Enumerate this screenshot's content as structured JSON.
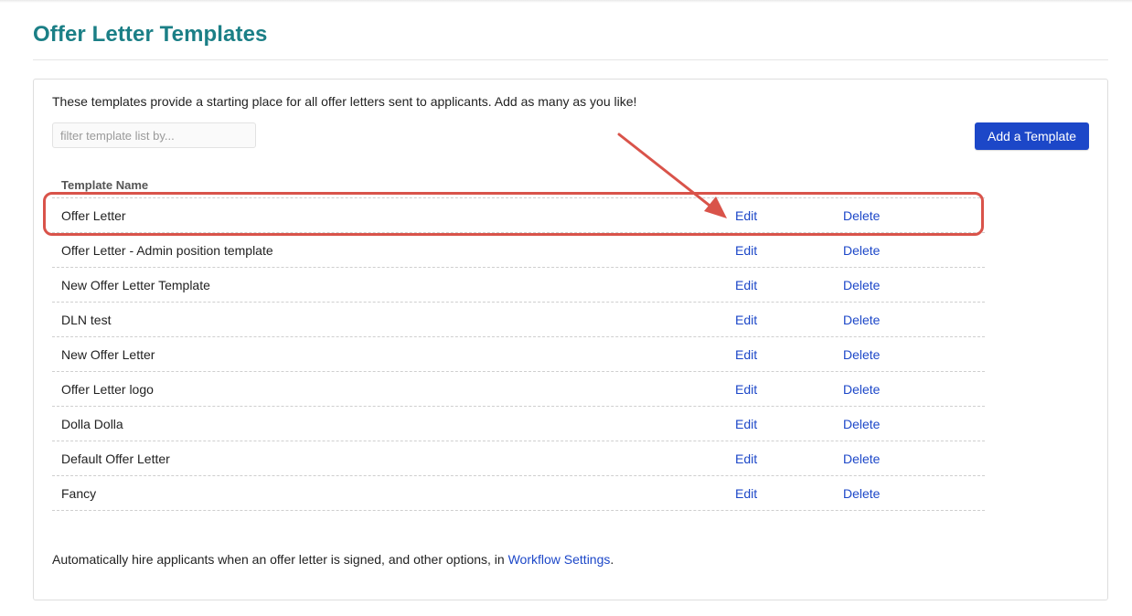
{
  "page": {
    "title": "Offer Letter Templates",
    "intro": "These templates provide a starting place for all offer letters sent to applicants. Add as many as you like!",
    "filter_placeholder": "filter template list by...",
    "add_button": "Add a Template"
  },
  "table": {
    "header": "Template Name",
    "edit_label": "Edit",
    "delete_label": "Delete",
    "rows": [
      {
        "name": "Offer Letter"
      },
      {
        "name": "Offer Letter - Admin position template"
      },
      {
        "name": "New Offer Letter Template"
      },
      {
        "name": "DLN test"
      },
      {
        "name": "New Offer Letter"
      },
      {
        "name": "Offer Letter logo"
      },
      {
        "name": "Dolla Dolla"
      },
      {
        "name": "Default Offer Letter"
      },
      {
        "name": "Fancy"
      }
    ]
  },
  "footer": {
    "text": "Automatically hire applicants when an offer letter is signed, and other options, in ",
    "link": "Workflow Settings",
    "suffix": "."
  },
  "annotation": {
    "color": "#d9534a",
    "highlighted_row": "Offer Letter"
  },
  "colors": {
    "title": "#1b7f86",
    "accent": "#1c47c8"
  }
}
